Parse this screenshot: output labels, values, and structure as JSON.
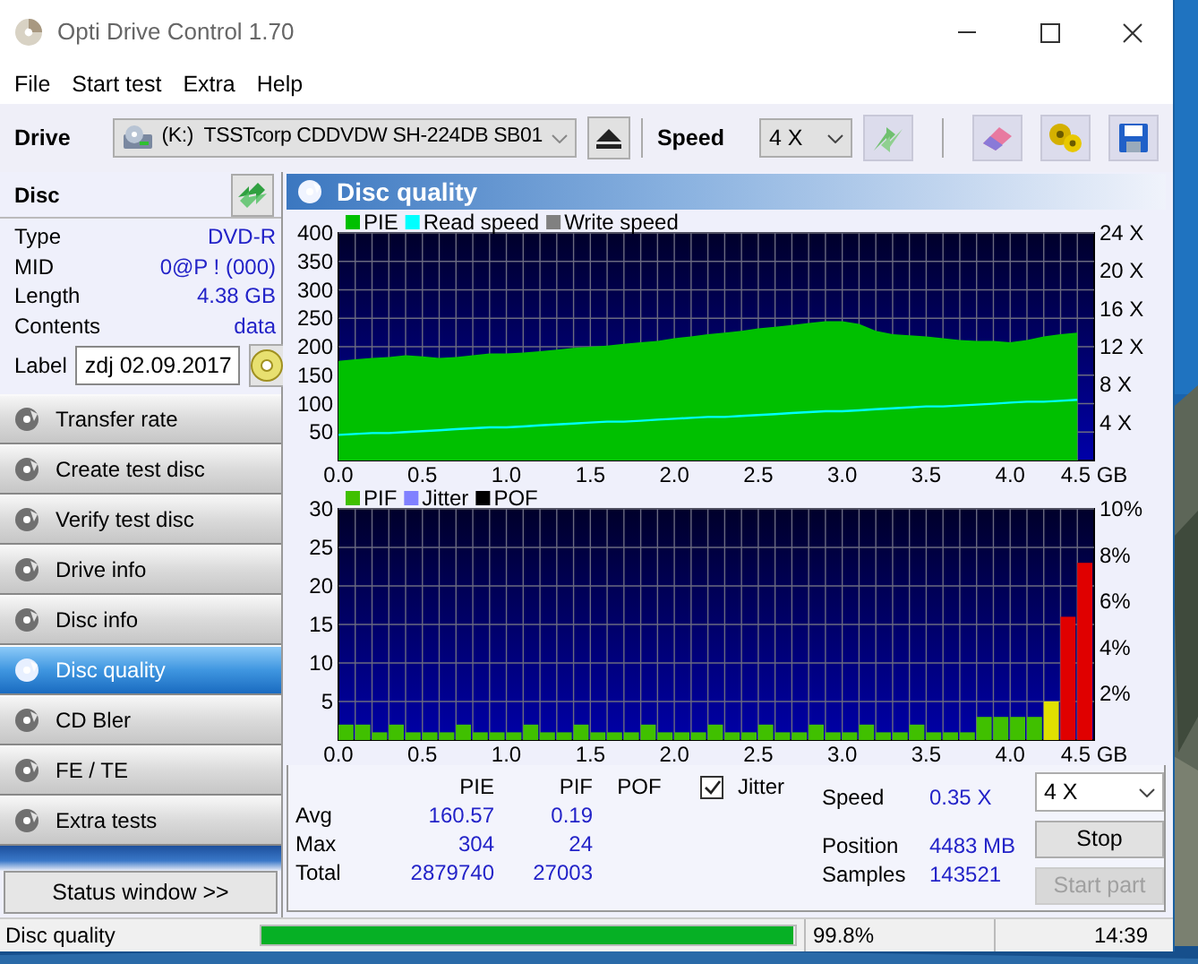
{
  "window": {
    "title": "Opti Drive Control 1.70"
  },
  "menu": [
    "File",
    "Start test",
    "Extra",
    "Help"
  ],
  "toolbar": {
    "drive_label": "Drive",
    "drive": "(K:)  TSSTcorp CDDVDW SH-224DB SB01",
    "speed_label": "Speed",
    "speed": "4 X"
  },
  "disc": {
    "title": "Disc",
    "info": [
      {
        "label": "Type",
        "value": "DVD-R"
      },
      {
        "label": "MID",
        "value": "0@P ! (000)"
      },
      {
        "label": "Length",
        "value": "4.38 GB"
      },
      {
        "label": "Contents",
        "value": "data"
      }
    ],
    "label": {
      "caption": "Label",
      "value": "zdj 02.09.2017"
    }
  },
  "nav": [
    {
      "label": "Transfer rate",
      "selected": false
    },
    {
      "label": "Create test disc",
      "selected": false
    },
    {
      "label": "Verify test disc",
      "selected": false
    },
    {
      "label": "Drive info",
      "selected": false
    },
    {
      "label": "Disc info",
      "selected": false
    },
    {
      "label": "Disc quality",
      "selected": true
    },
    {
      "label": "CD Bler",
      "selected": false
    },
    {
      "label": "FE / TE",
      "selected": false
    },
    {
      "label": "Extra tests",
      "selected": false
    }
  ],
  "status_window_button": "Status window >>",
  "panel": {
    "title": "Disc quality",
    "charts": [
      {
        "chart_data": {
          "type": "area",
          "x": [
            0,
            0.1,
            0.2,
            0.3,
            0.4,
            0.5,
            0.6,
            0.7,
            0.8,
            0.9,
            1.0,
            1.1,
            1.2,
            1.3,
            1.4,
            1.5,
            1.6,
            1.7,
            1.8,
            1.9,
            2.0,
            2.1,
            2.2,
            2.3,
            2.4,
            2.5,
            2.6,
            2.7,
            2.8,
            2.9,
            3.0,
            3.1,
            3.2,
            3.3,
            3.4,
            3.5,
            3.6,
            3.7,
            3.8,
            3.9,
            4.0,
            4.1,
            4.2,
            4.3,
            4.4
          ],
          "series": [
            {
              "name": "PIE",
              "color": "#00c000",
              "values": [
                175,
                178,
                180,
                182,
                185,
                183,
                180,
                182,
                185,
                188,
                188,
                190,
                192,
                195,
                198,
                200,
                202,
                205,
                208,
                210,
                215,
                218,
                222,
                225,
                228,
                232,
                235,
                238,
                242,
                245,
                245,
                240,
                228,
                222,
                220,
                218,
                215,
                212,
                210,
                210,
                208,
                212,
                218,
                222,
                225
              ]
            },
            {
              "name": "Read speed",
              "type": "line",
              "color": "#00ffff",
              "axis": "y2",
              "values": [
                2.7,
                2.8,
                2.9,
                2.9,
                3.0,
                3.1,
                3.2,
                3.3,
                3.4,
                3.5,
                3.5,
                3.6,
                3.7,
                3.8,
                3.9,
                4.0,
                4.1,
                4.1,
                4.2,
                4.3,
                4.4,
                4.5,
                4.6,
                4.6,
                4.7,
                4.8,
                4.9,
                5.0,
                5.1,
                5.2,
                5.2,
                5.3,
                5.4,
                5.5,
                5.6,
                5.7,
                5.7,
                5.8,
                5.9,
                6.0,
                6.1,
                6.2,
                6.2,
                6.3,
                6.4
              ]
            },
            {
              "name": "Write speed",
              "color": "#808080",
              "values": [
                null,
                null,
                null,
                null,
                null,
                null,
                null,
                null,
                null,
                null,
                null,
                null,
                null,
                null,
                null,
                null,
                null,
                null,
                null,
                null,
                null,
                null,
                null,
                null,
                null,
                null,
                null,
                null,
                null,
                null,
                null,
                null,
                null,
                null,
                null,
                null,
                null,
                null,
                null,
                null,
                null,
                null,
                null,
                null,
                null
              ]
            }
          ],
          "xlim": [
            0,
            4.5
          ],
          "ylim": [
            0,
            400
          ],
          "y2lim": [
            0,
            24
          ],
          "grid": true,
          "legend": "top",
          "xticks": [
            {
              "value": 0,
              "label": "0.0"
            },
            {
              "value": 0.5,
              "label": "0.5"
            },
            {
              "value": 1,
              "label": "1.0"
            },
            {
              "value": 1.5,
              "label": "1.5"
            },
            {
              "value": 2,
              "label": "2.0"
            },
            {
              "value": 2.5,
              "label": "2.5"
            },
            {
              "value": 3,
              "label": "3.0"
            },
            {
              "value": 3.5,
              "label": "3.5"
            },
            {
              "value": 4,
              "label": "4.0"
            },
            {
              "value": 4.5,
              "label": "4.5 GB"
            }
          ],
          "yticks": [
            50,
            100,
            150,
            200,
            250,
            300,
            350,
            400
          ],
          "y2ticks": [
            {
              "value": 4,
              "label": "4 X"
            },
            {
              "value": 8,
              "label": "8 X"
            },
            {
              "value": 12,
              "label": "12 X"
            },
            {
              "value": 16,
              "label": "16 X"
            },
            {
              "value": 20,
              "label": "20 X"
            },
            {
              "value": 24,
              "label": "24 X"
            }
          ]
        }
      },
      {
        "chart_data": {
          "type": "bar",
          "x": [
            0,
            0.1,
            0.2,
            0.3,
            0.4,
            0.5,
            0.6,
            0.7,
            0.8,
            0.9,
            1.0,
            1.1,
            1.2,
            1.3,
            1.4,
            1.5,
            1.6,
            1.7,
            1.8,
            1.9,
            2.0,
            2.1,
            2.2,
            2.3,
            2.4,
            2.5,
            2.6,
            2.7,
            2.8,
            2.9,
            3.0,
            3.1,
            3.2,
            3.3,
            3.4,
            3.5,
            3.6,
            3.7,
            3.8,
            3.9,
            4.0,
            4.1,
            4.2,
            4.3,
            4.4
          ],
          "series": [
            {
              "name": "PIF",
              "color": "#40c000",
              "values": [
                2,
                2,
                1,
                2,
                1,
                1,
                1,
                2,
                1,
                1,
                1,
                2,
                1,
                1,
                2,
                1,
                1,
                1,
                2,
                1,
                1,
                1,
                2,
                1,
                1,
                2,
                1,
                1,
                2,
                1,
                1,
                2,
                1,
                1,
                2,
                1,
                1,
                1,
                3,
                3,
                3,
                3,
                5,
                16,
                23
              ],
              "colors": [
                "#40c000",
                "#40c000",
                "#40c000",
                "#40c000",
                "#40c000",
                "#40c000",
                "#40c000",
                "#40c000",
                "#40c000",
                "#40c000",
                "#40c000",
                "#40c000",
                "#40c000",
                "#40c000",
                "#40c000",
                "#40c000",
                "#40c000",
                "#40c000",
                "#40c000",
                "#40c000",
                "#40c000",
                "#40c000",
                "#40c000",
                "#40c000",
                "#40c000",
                "#40c000",
                "#40c000",
                "#40c000",
                "#40c000",
                "#40c000",
                "#40c000",
                "#40c000",
                "#40c000",
                "#40c000",
                "#40c000",
                "#40c000",
                "#40c000",
                "#40c000",
                "#40c000",
                "#40c000",
                "#40c000",
                "#40c000",
                "#e0e000",
                "#e00000",
                "#e00000"
              ]
            },
            {
              "name": "Jitter",
              "color": "#8080ff",
              "values": [
                null,
                null,
                null,
                null,
                null,
                null,
                null,
                null,
                null,
                null,
                null,
                null,
                null,
                null,
                null,
                null,
                null,
                null,
                null,
                null,
                null,
                null,
                null,
                null,
                null,
                null,
                null,
                null,
                null,
                null,
                null,
                null,
                null,
                null,
                null,
                null,
                null,
                null,
                null,
                null,
                null,
                null,
                null,
                null,
                null
              ]
            },
            {
              "name": "POF",
              "color": "#000000",
              "values": [
                null,
                null,
                null,
                null,
                null,
                null,
                null,
                null,
                null,
                null,
                null,
                null,
                null,
                null,
                null,
                null,
                null,
                null,
                null,
                null,
                null,
                null,
                null,
                null,
                null,
                null,
                null,
                null,
                null,
                null,
                null,
                null,
                null,
                null,
                null,
                null,
                null,
                null,
                null,
                null,
                null,
                null,
                null,
                null,
                null
              ]
            }
          ],
          "xlim": [
            0,
            4.5
          ],
          "ylim": [
            0,
            30
          ],
          "y2lim": [
            0,
            10
          ],
          "grid": true,
          "legend": "top",
          "xticks": [
            {
              "value": 0,
              "label": "0.0"
            },
            {
              "value": 0.5,
              "label": "0.5"
            },
            {
              "value": 1,
              "label": "1.0"
            },
            {
              "value": 1.5,
              "label": "1.5"
            },
            {
              "value": 2,
              "label": "2.0"
            },
            {
              "value": 2.5,
              "label": "2.5"
            },
            {
              "value": 3,
              "label": "3.0"
            },
            {
              "value": 3.5,
              "label": "3.5"
            },
            {
              "value": 4,
              "label": "4.0"
            },
            {
              "value": 4.5,
              "label": "4.5 GB"
            }
          ],
          "yticks": [
            5,
            10,
            15,
            20,
            25,
            30
          ],
          "y2ticks": [
            {
              "value": 2,
              "label": "2%"
            },
            {
              "value": 4,
              "label": "4%"
            },
            {
              "value": 6,
              "label": "6%"
            },
            {
              "value": 8,
              "label": "8%"
            },
            {
              "value": 10,
              "label": "10%"
            }
          ]
        }
      }
    ]
  },
  "stats": {
    "columns": [
      "PIE",
      "PIF",
      "POF"
    ],
    "jitter": {
      "label": "Jitter",
      "checked": true
    },
    "rows": [
      {
        "label": "Avg",
        "values": [
          "160.57",
          "0.19"
        ]
      },
      {
        "label": "Max",
        "values": [
          "304",
          "24"
        ]
      },
      {
        "label": "Total",
        "values": [
          "2879740",
          "27003"
        ]
      }
    ],
    "readings": [
      {
        "label": "Speed",
        "value": "0.35 X"
      },
      {
        "label": "Position",
        "value": "4483 MB"
      },
      {
        "label": "Samples",
        "value": "143521"
      }
    ],
    "speed_select": "4 X",
    "buttons": [
      {
        "label": "Stop",
        "disabled": false
      },
      {
        "label": "Start part",
        "disabled": true
      }
    ]
  },
  "status_bar": {
    "text": "Disc quality",
    "level": 0.998,
    "percent": "99.8%",
    "time": "14:39"
  }
}
